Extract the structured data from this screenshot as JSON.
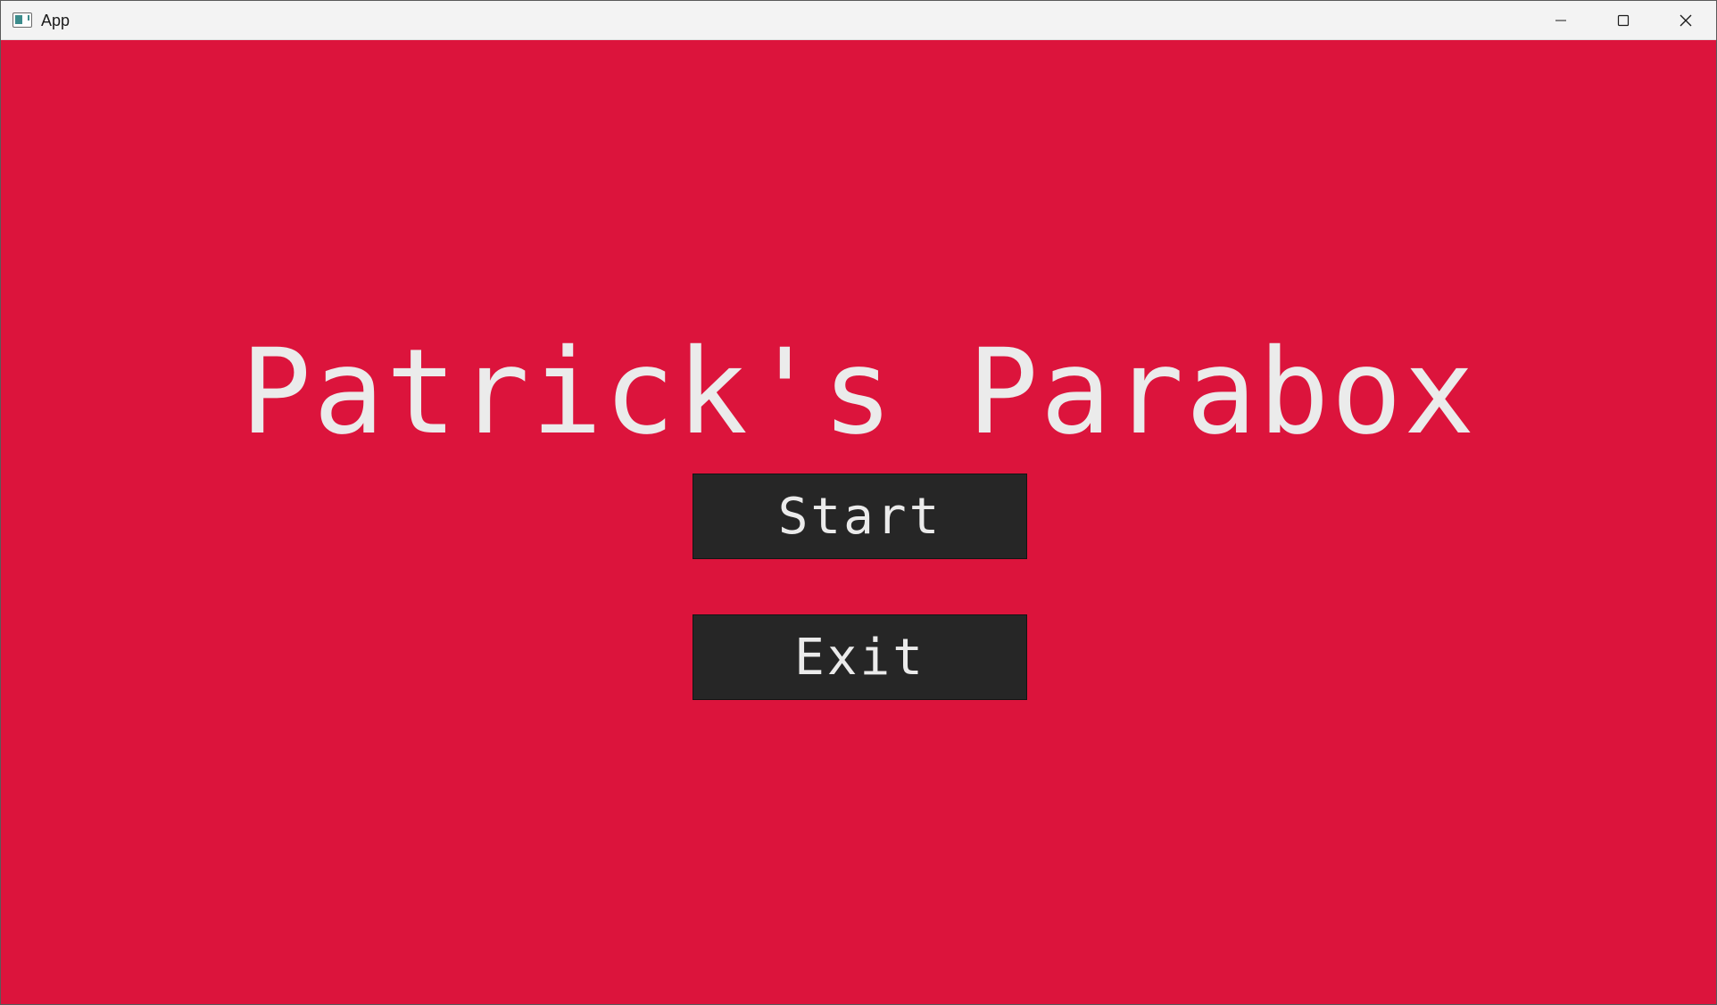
{
  "window": {
    "title": "App",
    "controls": {
      "minimize_icon": "minimize-icon",
      "maximize_icon": "maximize-icon",
      "close_icon": "close-icon"
    }
  },
  "game": {
    "title": "Patrick's Parabox",
    "background_color": "#dc143c",
    "text_color": "#ebebeb",
    "button_color": "#262626"
  },
  "menu": {
    "start_label": "Start",
    "exit_label": "Exit"
  }
}
